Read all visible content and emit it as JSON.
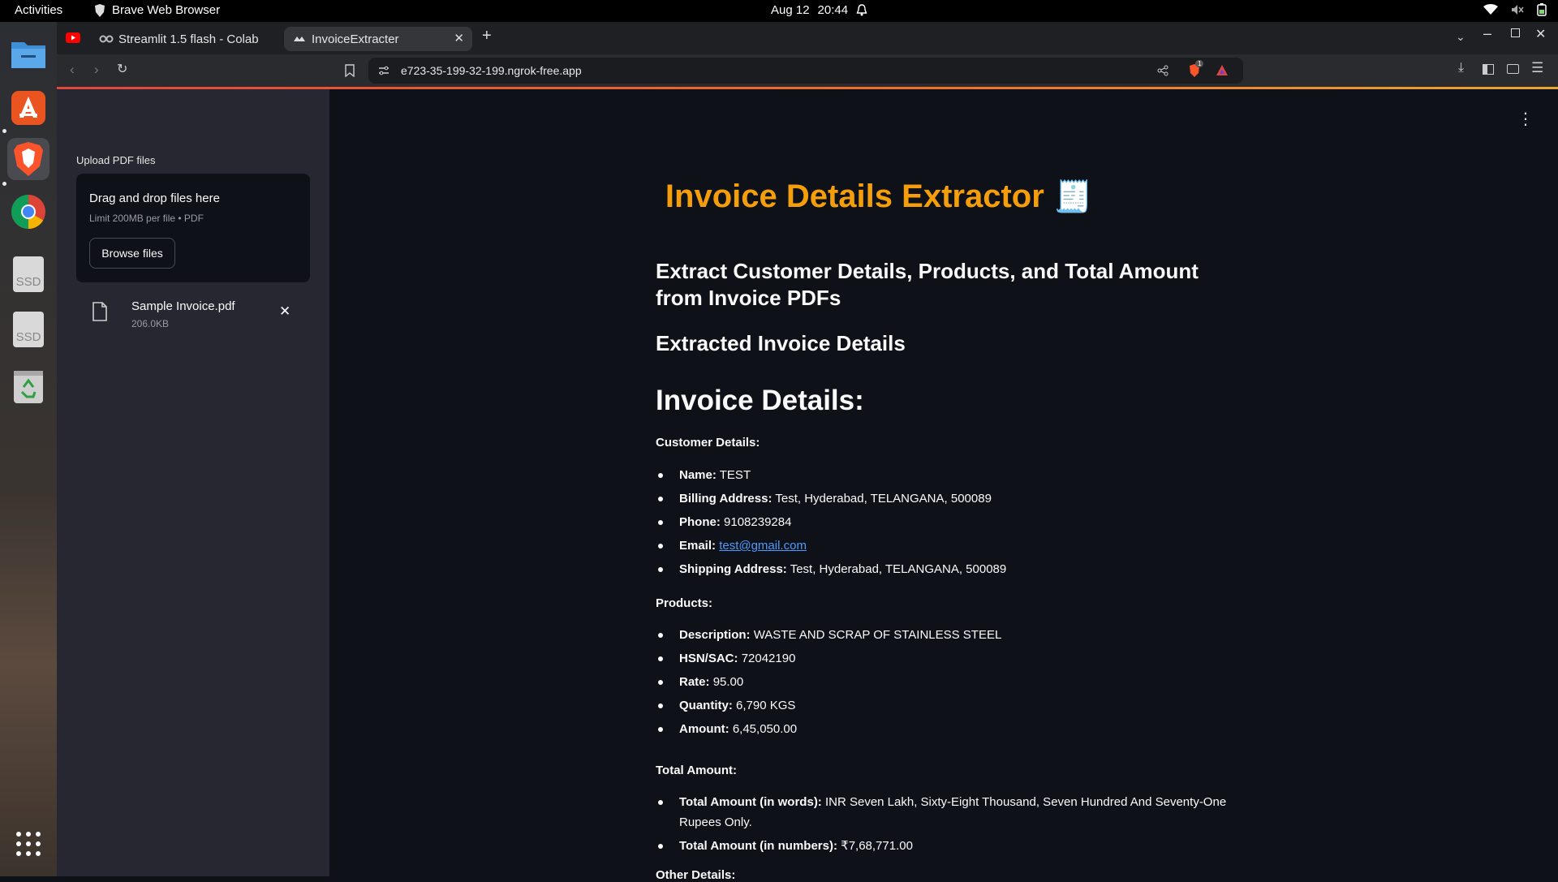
{
  "os": {
    "activities": "Activities",
    "app_name": "Brave Web Browser",
    "date": "Aug 12",
    "time": "20:44"
  },
  "browser": {
    "tabs": [
      {
        "label": "Streamlit 1.5 flash - Colab"
      },
      {
        "label": "InvoiceExtracter"
      }
    ],
    "url": "e723-35-199-32-199.ngrok-free.app",
    "brave_badge": "1"
  },
  "sidebar": {
    "upload_label": "Upload PDF files",
    "dropzone_title": "Drag and drop files here",
    "dropzone_limit": "Limit 200MB per file • PDF",
    "browse_button": "Browse files",
    "file": {
      "name": "Sample Invoice.pdf",
      "size": "206.0KB"
    }
  },
  "dock": {
    "ssd1": "SSD",
    "ssd2": "SSD"
  },
  "main": {
    "title": "Invoice Details Extractor",
    "title_emoji": "🧾",
    "subtitle": "Extract Customer Details, Products, and Total Amount from Invoice PDFs",
    "extracted_heading": "Extracted Invoice Details",
    "invoice_heading": "Invoice Details:",
    "customer_heading": "Customer Details:",
    "customer": [
      {
        "label": "Name:",
        "value": "TEST"
      },
      {
        "label": "Billing Address:",
        "value": "Test, Hyderabad, TELANGANA, 500089"
      },
      {
        "label": "Phone:",
        "value": "9108239284"
      },
      {
        "label": "Email:",
        "value": "test@gmail.com"
      },
      {
        "label": "Shipping Address:",
        "value": "Test, Hyderabad, TELANGANA, 500089"
      }
    ],
    "products_heading": "Products:",
    "products": [
      {
        "label": "Description:",
        "value": "WASTE AND SCRAP OF STAINLESS STEEL"
      },
      {
        "label": "HSN/SAC:",
        "value": "72042190"
      },
      {
        "label": "Rate:",
        "value": "95.00"
      },
      {
        "label": "Quantity:",
        "value": "6,790 KGS"
      },
      {
        "label": "Amount:",
        "value": "6,45,050.00"
      }
    ],
    "total_heading": "Total Amount:",
    "totals": [
      {
        "label": "Total Amount (in words):",
        "value": "INR Seven Lakh, Sixty-Eight Thousand, Seven Hundred And Seventy-One Rupees Only."
      },
      {
        "label": "Total Amount (in numbers):",
        "value": "₹7,68,771.00"
      }
    ],
    "other_heading": "Other Details:"
  },
  "colors": {
    "accent_title": "#f59e0b",
    "link": "#4b9cff",
    "sidebar_bg": "#262730",
    "main_bg": "#0e1117"
  }
}
